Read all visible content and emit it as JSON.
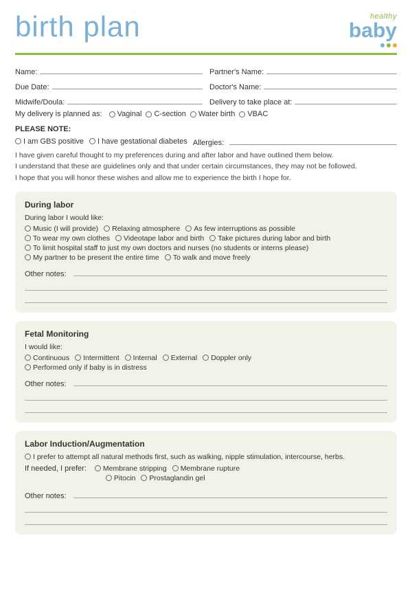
{
  "header": {
    "title": "birth plan",
    "logo_healthy": "healthy",
    "logo_baby": "baby"
  },
  "form": {
    "name_label": "Name:",
    "partners_name_label": "Partner's Name:",
    "due_date_label": "Due Date:",
    "doctors_name_label": "Doctor's Name:",
    "midwife_label": "Midwife/Doula:",
    "delivery_place_label": "Delivery to take place at:",
    "delivery_planned_label": "My delivery is planned as:",
    "delivery_options": [
      "Vaginal",
      "C-section",
      "Water birth",
      "VBAC"
    ]
  },
  "please_note": {
    "label": "PLEASE NOTE:",
    "items": [
      "I am GBS positive",
      "I have gestational diabetes"
    ],
    "allergies_label": "Allergies:"
  },
  "intro": {
    "line1": "I have given careful thought to my preferences during and after labor and have outlined them below.",
    "line2": "I understand that these are guidelines only and that under certain circumstances, they may not be followed.",
    "line3": "I hope that you will honor these wishes and allow me to experience the birth I hope for."
  },
  "sections": [
    {
      "id": "during-labor",
      "title": "During labor",
      "intro": "During labor I would like:",
      "options_rows": [
        [
          "Music (I will provide)",
          "Relaxing atmosphere",
          "As few interruptions as possible"
        ],
        [
          "To wear my own clothes",
          "Videotape labor and birth",
          "Take pictures during labor and birth"
        ],
        [
          "To limit hospital staff to just my own doctors and nurses (no students or interns please)"
        ],
        [
          "My partner to be present the entire time",
          "To walk and move freely"
        ]
      ],
      "other_notes_label": "Other notes:"
    },
    {
      "id": "fetal-monitoring",
      "title": "Fetal Monitoring",
      "intro": "I would like:",
      "options_rows": [
        [
          "Continuous",
          "Intermittent",
          "Internal",
          "External",
          "Doppler only"
        ],
        [
          "Performed only if baby is in distress"
        ]
      ],
      "other_notes_label": "Other notes:"
    },
    {
      "id": "labor-induction",
      "title": "Labor Induction/Augmentation",
      "intro": "I prefer to attempt all natural methods first, such as walking, nipple stimulation, intercourse, herbs.",
      "if_needed_label": "If needed, I prefer:",
      "options_rows": [
        [
          "Membrane stripping",
          "Membrane rupture"
        ],
        [
          "Pitocin",
          "Prostaglandin gel"
        ]
      ],
      "other_notes_label": "Other notes:"
    }
  ],
  "colors": {
    "accent_blue": "#7ab0d4",
    "accent_green": "#8bbc3c",
    "accent_orange": "#f0a830",
    "section_bg": "#f0f4e8"
  }
}
